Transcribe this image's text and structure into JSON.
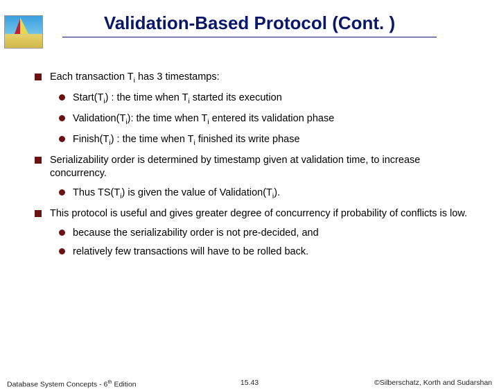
{
  "title": "Validation-Based Protocol (Cont. )",
  "bullets": {
    "b1_1_pre": "Each transaction T",
    "b1_1_post": " has 3 timestamps:",
    "b2_1_pre": "Start(T",
    "b2_1_mid": ") : the time when T",
    "b2_1_post": " started its execution",
    "b2_2_pre": "Validation(T",
    "b2_2_mid": "): the time when T",
    "b2_2_post": " entered its validation phase",
    "b2_3_pre": "Finish(T",
    "b2_3_mid": ") : the time when T",
    "b2_3_post": " finished its write phase",
    "b1_2": "Serializability order is determined by timestamp given at validation time,  to increase concurrency.",
    "b2_4_pre": "Thus TS(T",
    "b2_4_mid": ") is given the value of Validation(T",
    "b2_4_post": ").",
    "b1_3": "This protocol is useful and gives greater degree of concurrency if probability of conflicts is low.",
    "b2_5": "because the serializability order is not pre-decided, and",
    "b2_6": "relatively few transactions will have to be rolled back."
  },
  "sub_i": "i",
  "footer": {
    "left_pre": "Database System Concepts - 6",
    "left_sup": "th",
    "left_post": " Edition",
    "center": "15.43",
    "right": "©Silberschatz, Korth and Sudarshan"
  }
}
